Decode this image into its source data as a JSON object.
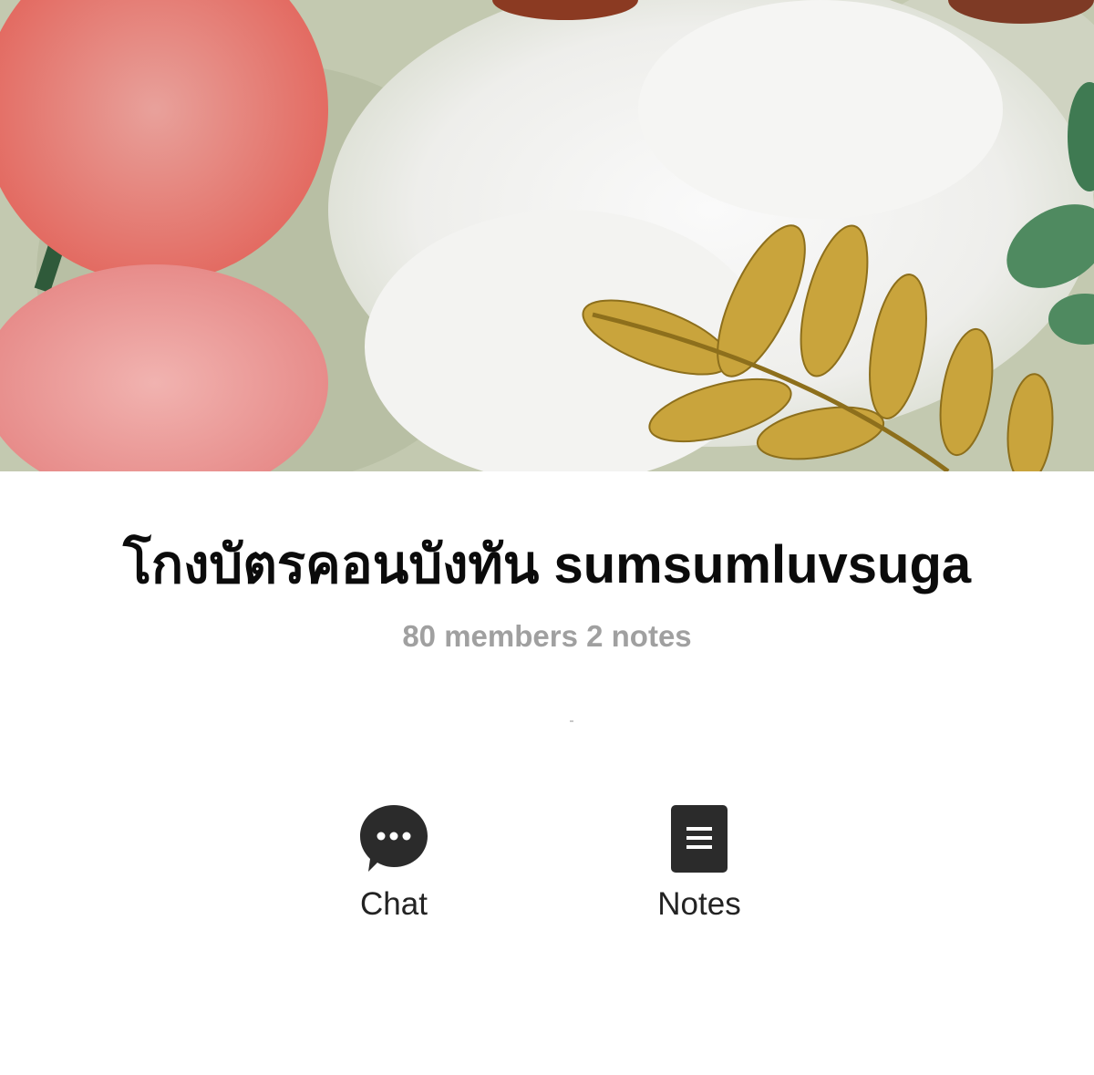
{
  "group": {
    "name": "โกงบัตรคอนบังทัน sumsumluvsuga",
    "meta": "80 members 2 notes"
  },
  "actions": [
    {
      "label": "Chat",
      "icon": "chat-bubble-icon"
    },
    {
      "label": "Notes",
      "icon": "document-icon"
    }
  ],
  "colors": {
    "title": "#0b0b0b",
    "meta": "#a0a0a0",
    "icon": "#2b2b2b",
    "label": "#232323"
  }
}
